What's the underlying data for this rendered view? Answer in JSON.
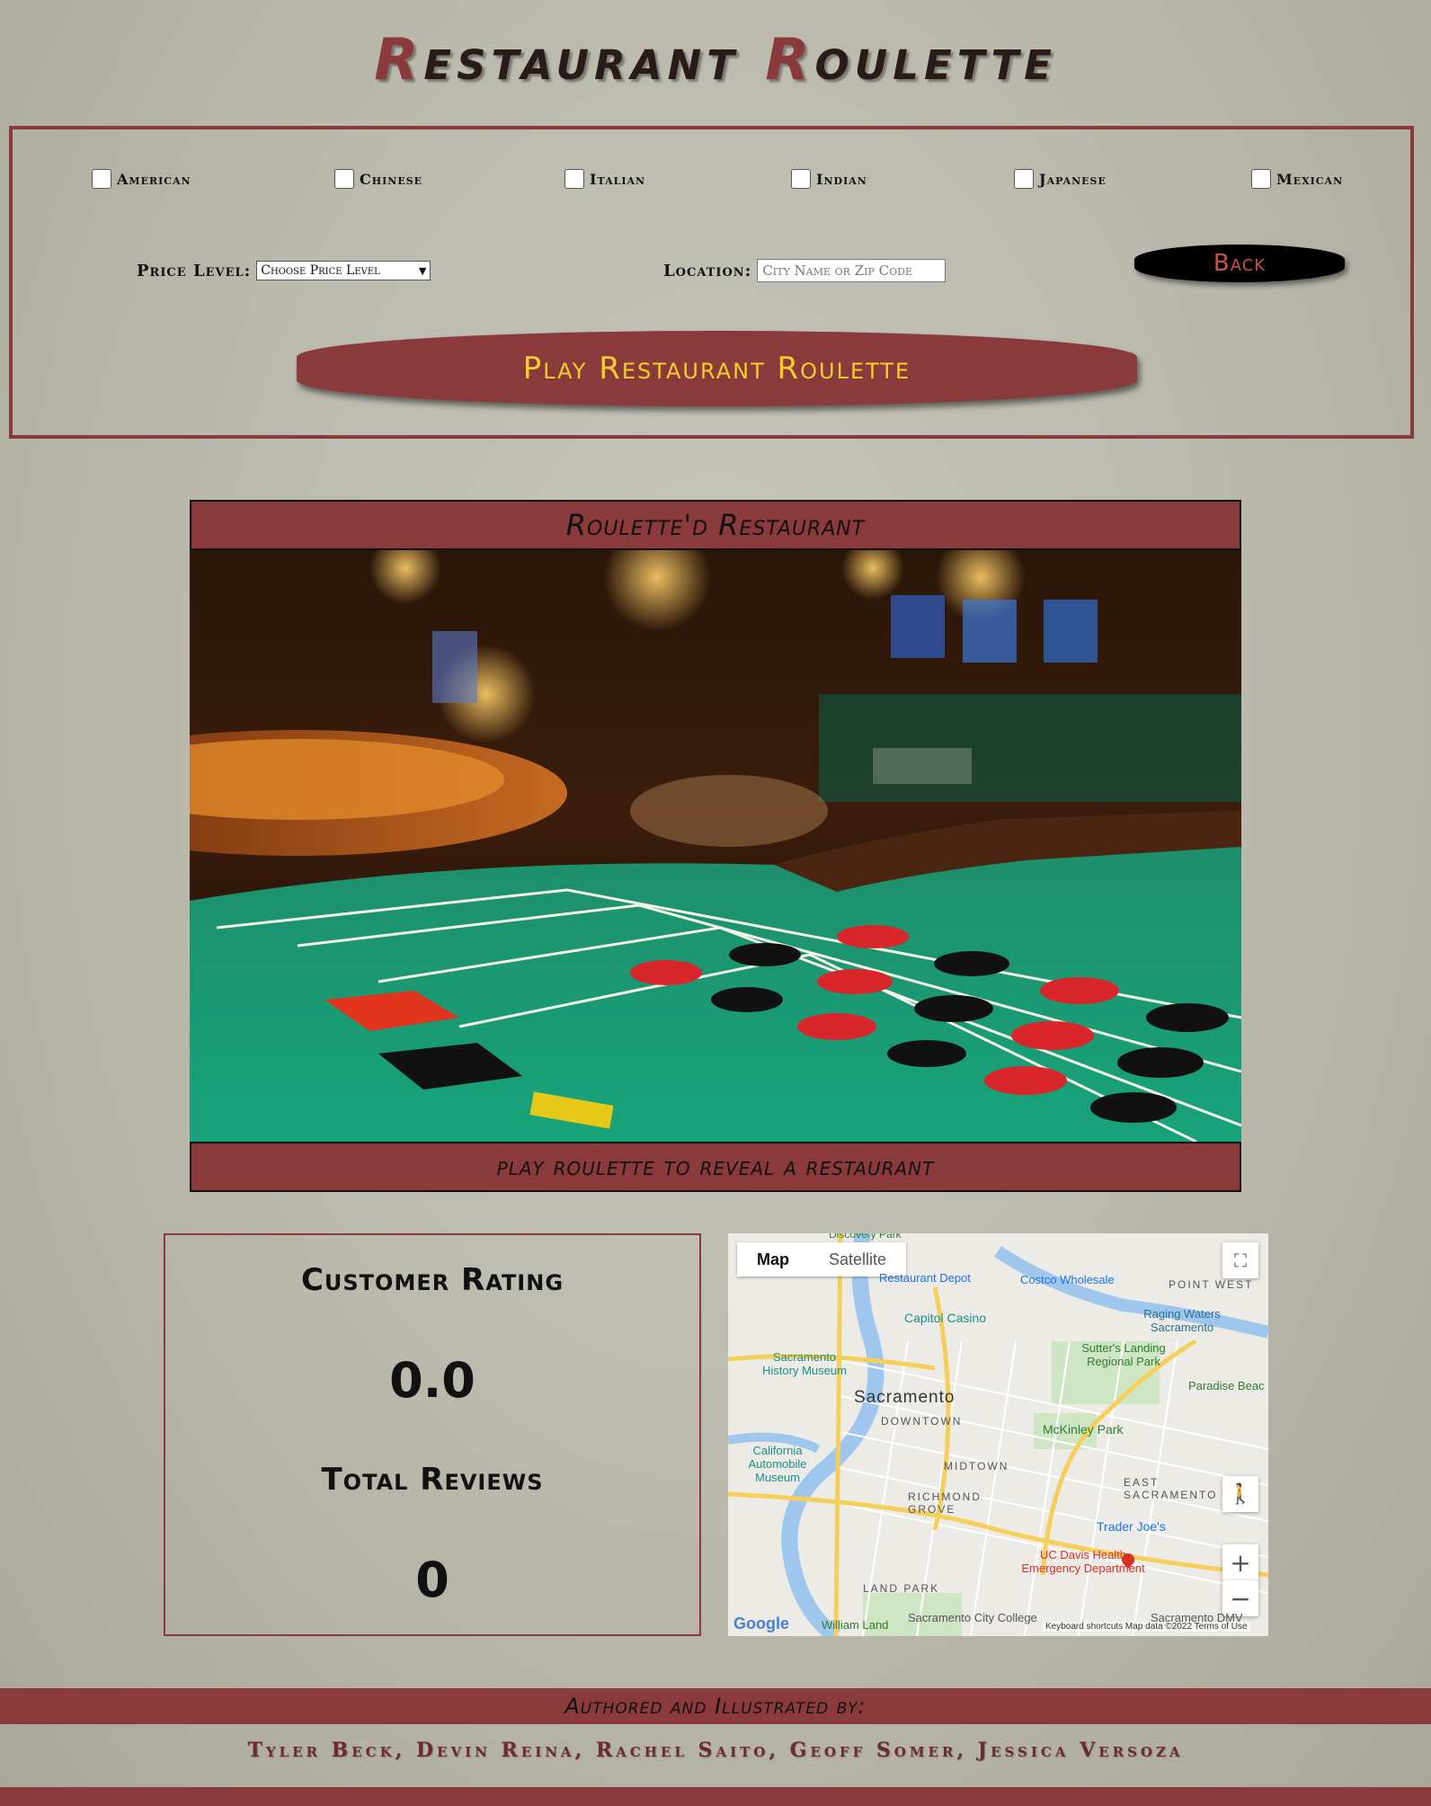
{
  "app": {
    "title_rest": "estaurant ",
    "title_r1": "R",
    "title_r2": "R",
    "title_rest2": "oulette"
  },
  "filters": {
    "cuisines": [
      "American",
      "Chinese",
      "Italian",
      "Indian",
      "Japanese",
      "Mexican"
    ],
    "price_label": "Price Level:",
    "price_selected": "Choose Price Level",
    "location_label": "Location:",
    "location_placeholder": "City Name or Zip Code",
    "back_label": "Back",
    "play_label": "Play Restaurant Roulette"
  },
  "card": {
    "header": "Roulette'd Restaurant",
    "footer": "play roulette to reveal a restaurant"
  },
  "rating": {
    "rating_label": "Customer Rating",
    "rating_value": "0.0",
    "reviews_label": "Total Reviews",
    "reviews_value": "0"
  },
  "map": {
    "tab_map": "Map",
    "tab_satellite": "Satellite",
    "labels": {
      "sacramento": "Sacramento",
      "downtown": "DOWNTOWN",
      "midtown": "MIDTOWN",
      "richmond_grove": "RICHMOND GROVE",
      "east_sacramento": "EAST SACRAMENTO",
      "land_park": "LAND PARK",
      "point_west": "POINT WEST",
      "mckinley_park": "McKinley Park",
      "sutters_landing": "Sutter's Landing Regional Park",
      "raging_waters": "Raging Waters Sacramento",
      "costco": "Costco Wholesale",
      "restaurant_depot": "Restaurant Depot",
      "capitol_casino": "Capitol Casino",
      "history_museum": "Sacramento History Museum",
      "california_museum": "California Automobile Museum",
      "trader_joes": "Trader Joe's",
      "uc_davis": "UC Davis Health Emergency Department",
      "william_land": "William Land",
      "sac_city_college": "Sacramento City College",
      "sac_dmv": "Sacramento DMV",
      "paradise_beach": "Paradise Beac",
      "discovery_park": "Discovery Park",
      "google": "Google",
      "attribution": "Keyboard shortcuts   Map data ©2022   Terms of Use"
    }
  },
  "footer": {
    "authored_label": "Authored and Illustrated by:",
    "authors": "Tyler Beck, Devin Reina, Rachel Saito, Geoff Somer, Jessica Versoza"
  },
  "colors": {
    "maroon": "#8b3a3c",
    "gold": "#f2cf2a",
    "background": "#bdbcaf"
  }
}
